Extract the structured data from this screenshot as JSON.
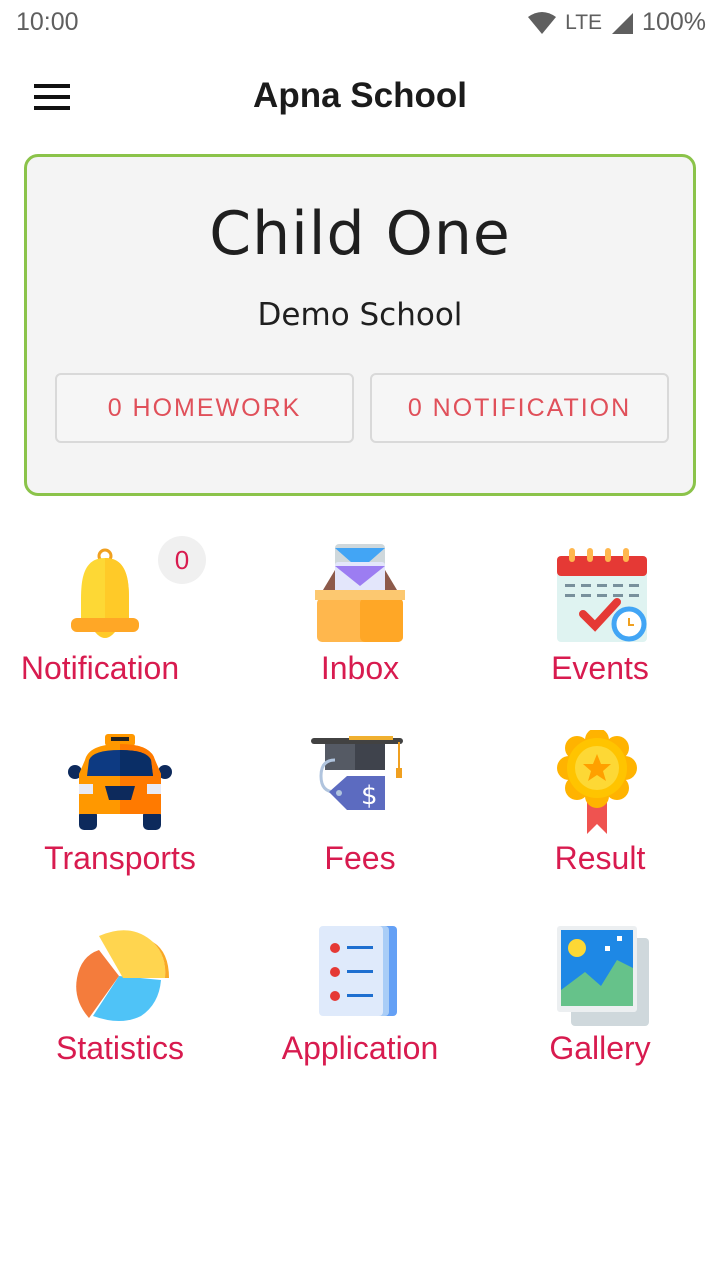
{
  "status_bar": {
    "time": "10:00",
    "network": "LTE",
    "battery": "100%",
    "icons": [
      "wifi-icon",
      "signal-icon"
    ]
  },
  "app_bar": {
    "title": "Apna School",
    "menu_icon": "hamburger-menu-icon"
  },
  "profile": {
    "child_name": "Child One",
    "school_name": "Demo School",
    "homework_button": "0 HOMEWORK",
    "notification_button": "0 NOTIFICATION",
    "border_color": "#8bc34a"
  },
  "menu_grid": {
    "label_color": "#d81b4f",
    "items": [
      {
        "label": "Notification",
        "icon": "bell-icon",
        "badge": "0"
      },
      {
        "label": "Inbox",
        "icon": "inbox-tray-icon"
      },
      {
        "label": "Events",
        "icon": "calendar-check-icon"
      },
      {
        "label": "Transports",
        "icon": "taxi-car-icon"
      },
      {
        "label": "Fees",
        "icon": "graduation-cap-price-tag-icon"
      },
      {
        "label": "Result",
        "icon": "award-medal-icon"
      },
      {
        "label": "Statistics",
        "icon": "pie-chart-icon"
      },
      {
        "label": "Application",
        "icon": "checklist-document-icon"
      },
      {
        "label": "Gallery",
        "icon": "picture-gallery-icon"
      }
    ]
  }
}
